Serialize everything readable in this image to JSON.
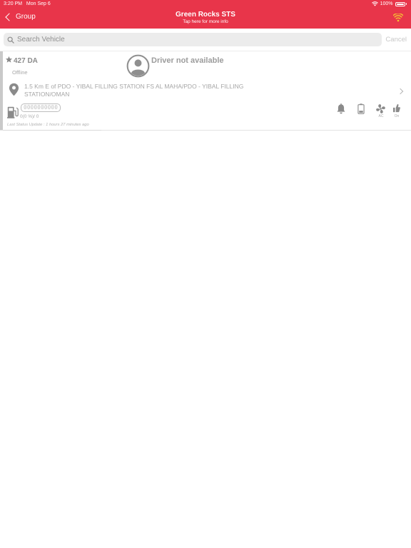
{
  "status_bar": {
    "time": "3:20 PM",
    "date": "Mon Sep 6",
    "battery": "100%"
  },
  "header": {
    "back_label": "Group",
    "title": "Green Rocks STS",
    "subtitle": "Tap here for more info",
    "wifi_color": "#f5c431"
  },
  "search": {
    "placeholder": "Search Vehicle",
    "value": "",
    "cancel_label": "Cancel"
  },
  "vehicles": [
    {
      "name": "427 DA",
      "status": "Offline",
      "driver": "Driver not available",
      "address": "1.5 Km E of PDO - YIBAL FILLING STATION FS AL MAHA/PDO - YIBAL FILLING STATION/OMAN",
      "odometer": "0000000000",
      "fuel": "0(0 %)/ 0",
      "last_update": "Last Status Update : 1 hours 27 minutes ago",
      "indicators": {
        "ac_label": "AC",
        "ignition_label": "On"
      }
    }
  ],
  "colors": {
    "accent": "#e8354a",
    "card_bar": "#c9c9c9",
    "icon": "#8a8a8a"
  }
}
